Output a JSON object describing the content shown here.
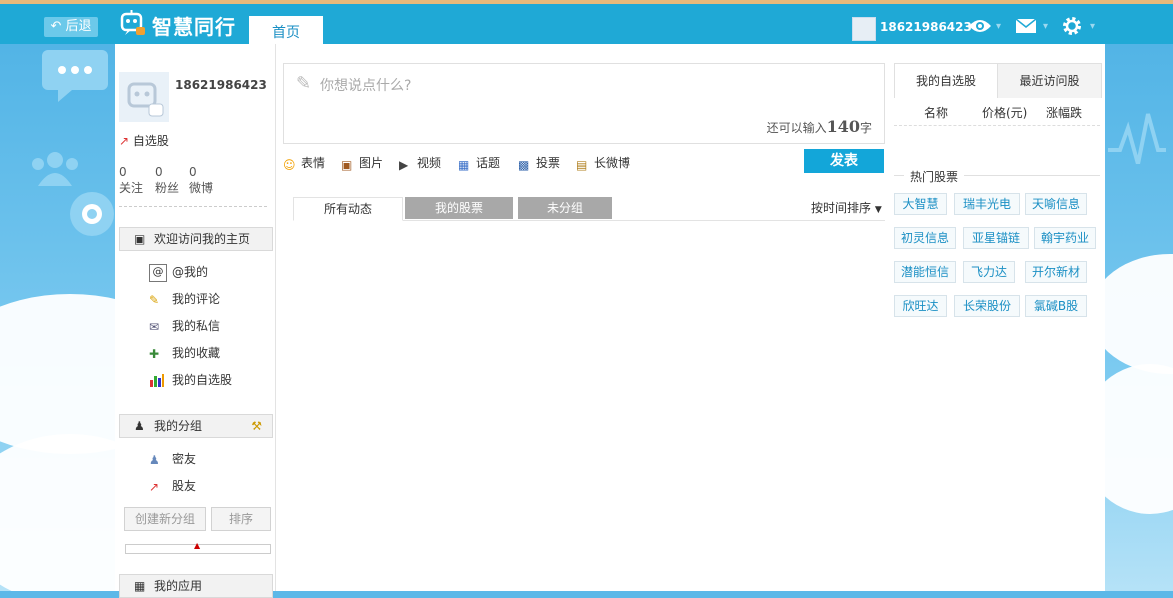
{
  "topbar": {
    "back_label": "后退",
    "app_title": "智慧同行",
    "home_tab": "首页",
    "username": "18621986423"
  },
  "profile": {
    "username": "18621986423",
    "watchlist_label": "自选股",
    "stats": [
      {
        "count": "0",
        "label": "关注"
      },
      {
        "count": "0",
        "label": "粉丝"
      },
      {
        "count": "0",
        "label": "微博"
      }
    ]
  },
  "sidebar": {
    "homepage_label": "欢迎访问我的主页",
    "menu": [
      {
        "label": "@我的",
        "icon": "at-icon"
      },
      {
        "label": "我的评论",
        "icon": "pencil-icon"
      },
      {
        "label": "我的私信",
        "icon": "mail-icon"
      },
      {
        "label": "我的收藏",
        "icon": "favorite-icon"
      },
      {
        "label": "我的自选股",
        "icon": "bar-chart-icon"
      }
    ],
    "groups_label": "我的分组",
    "groups": [
      {
        "label": "密友",
        "icon": "friends-icon"
      },
      {
        "label": "股友",
        "icon": "stock-trend-icon"
      }
    ],
    "create_group_label": "创建新分组",
    "sort_label": "排序",
    "apps_label": "我的应用"
  },
  "compose": {
    "placeholder": "你想说点什么?",
    "remaining_prefix": "还可以输入",
    "remaining_count": "140",
    "remaining_suffix": "字",
    "tools": [
      "表情",
      "图片",
      "视频",
      "话题",
      "投票",
      "长微博"
    ],
    "publish_label": "发表"
  },
  "feed": {
    "tabs": [
      "所有动态",
      "我的股票",
      "未分组"
    ],
    "active_tab": 0,
    "sort_label": "按时间排序"
  },
  "right": {
    "tabs": [
      "我的自选股",
      "最近访问股"
    ],
    "columns": [
      "名称",
      "价格(元)",
      "涨幅跌"
    ],
    "hot_title": "热门股票",
    "hot_stocks": [
      "大智慧",
      "瑞丰光电",
      "天喻信息",
      "初灵信息",
      "亚星锚链",
      "翰宇药业",
      "潜能恒信",
      "飞力达",
      "开尔新材",
      "欣旺达",
      "长荣股份",
      "氯碱B股"
    ]
  },
  "colors": {
    "topbar": "#1fa9d6",
    "accent": "#13a6d9",
    "link": "#1a8fc4"
  }
}
